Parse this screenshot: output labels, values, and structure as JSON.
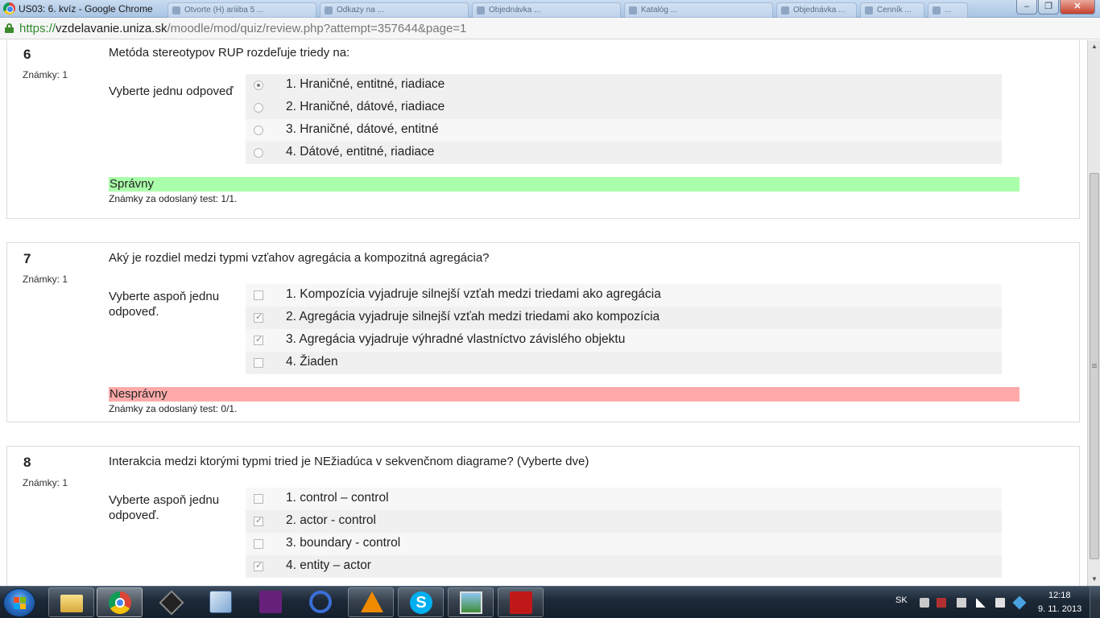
{
  "window": {
    "title": "US03: 6. kvíz - Google Chrome",
    "other_tabs": [
      "Otvorte (H) ariiiba 5 ...",
      "Odkazy na ...",
      "Objednávka ...",
      "Katalóg ...",
      "Objednávka ...",
      "Cenník ...",
      "..."
    ],
    "minimize": "–",
    "maximize": "❐",
    "close": "✕"
  },
  "address": {
    "scheme": "https://",
    "host": "vzdelavanie.uniza.sk",
    "path": "/moodle/mod/quiz/review.php?attempt=357644&page=1"
  },
  "questions": [
    {
      "number": "6",
      "grade": "Známky: 1",
      "text": "Metóda stereotypov RUP rozdeľuje triedy na:",
      "prompt": "Vyberte jednu odpoveď",
      "type": "radio",
      "answers": [
        {
          "label": "1. Hraničné, entitné, riadiace",
          "checked": true
        },
        {
          "label": "2. Hraničné, dátové, riadiace",
          "checked": false
        },
        {
          "label": "3. Hraničné, dátové, entitné",
          "checked": false
        },
        {
          "label": "4. Dátové, entitné, riadiace",
          "checked": false
        }
      ],
      "state": "Správny",
      "state_kind": "correct",
      "marks": "Známky za odoslaný test: 1/1."
    },
    {
      "number": "7",
      "grade": "Známky: 1",
      "text": "Aký je rozdiel medzi typmi vzťahov agregácia a kompozitná agregácia?",
      "prompt": "Vyberte aspoň jednu odpoveď.",
      "type": "checkbox",
      "answers": [
        {
          "label": "1. Kompozícia vyjadruje silnejší vzťah medzi triedami ako agregácia",
          "checked": false
        },
        {
          "label": "2. Agregácia vyjadruje silnejší vzťah medzi triedami ako kompozícia",
          "checked": true
        },
        {
          "label": "3. Agregácia vyjadruje výhradné vlastníctvo závislého objektu",
          "checked": true
        },
        {
          "label": "4. Žiaden",
          "checked": false
        }
      ],
      "state": "Nesprávny",
      "state_kind": "incorrect",
      "marks": "Známky za odoslaný test: 0/1."
    },
    {
      "number": "8",
      "grade": "Známky: 1",
      "text": "Interakcia medzi ktorými typmi tried je NEžiadúca v sekvenčnom diagrame? (Vyberte dve)",
      "prompt": "Vyberte aspoň jednu odpoveď.",
      "type": "checkbox",
      "answers": [
        {
          "label": "1. control – control",
          "checked": false
        },
        {
          "label": "2. actor - control",
          "checked": true
        },
        {
          "label": "3. boundary - control",
          "checked": false
        },
        {
          "label": "4. entity – actor",
          "checked": true
        }
      ]
    }
  ],
  "taskbar": {
    "apps": [
      "start-menu",
      "file-explorer",
      "google-chrome",
      "unity",
      "virtualbox",
      "visual-studio",
      "app-launcher",
      "vlc-player",
      "skype",
      "photo-viewer",
      "adobe-reader"
    ],
    "language": "SK",
    "time": "12:18",
    "date": "9. 11. 2013"
  }
}
